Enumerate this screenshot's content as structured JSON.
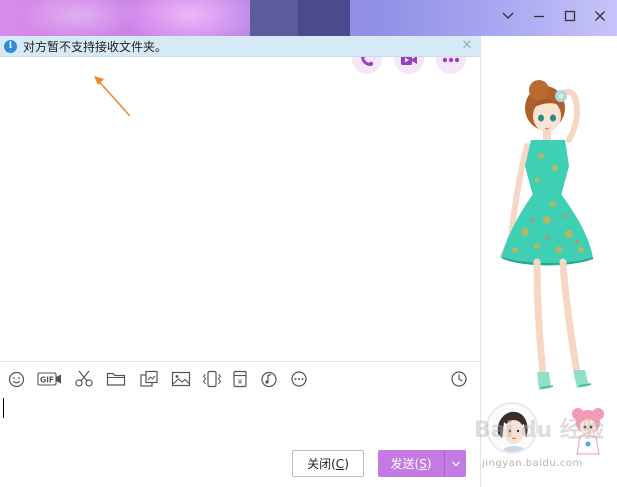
{
  "window": {
    "controls": [
      "chevron-down-icon",
      "minimize-icon",
      "maximize-icon",
      "close-icon"
    ]
  },
  "notice": {
    "text": "对方暂不支持接收文件夹。",
    "icon": "info-icon",
    "accent": "#2f8bd6",
    "background": "#d6e9f7"
  },
  "actions": [
    "phone-icon",
    "video-icon",
    "more-icon"
  ],
  "toolbar": {
    "items": [
      "emoji-icon",
      "gif-icon",
      "scissors-icon",
      "folder-icon",
      "image-magic-icon",
      "image-icon",
      "shake-icon",
      "red-packet-icon",
      "music-icon",
      "more-icon"
    ],
    "gif_label": "GIF",
    "history": "clock-icon"
  },
  "buttons": {
    "close_label": "关闭(",
    "close_key": "C",
    "close_end": ")",
    "send_label": "发送(",
    "send_key": "S",
    "send_end": ")",
    "send_color": "#c37be3"
  },
  "watermark": {
    "brand": "Bai du 经验",
    "url": "jingyan.baidu.com"
  },
  "colors": {
    "title_gradient_start": "#d98be9",
    "title_gradient_end": "#c6c4f8",
    "dress": "#3fcfb5"
  }
}
